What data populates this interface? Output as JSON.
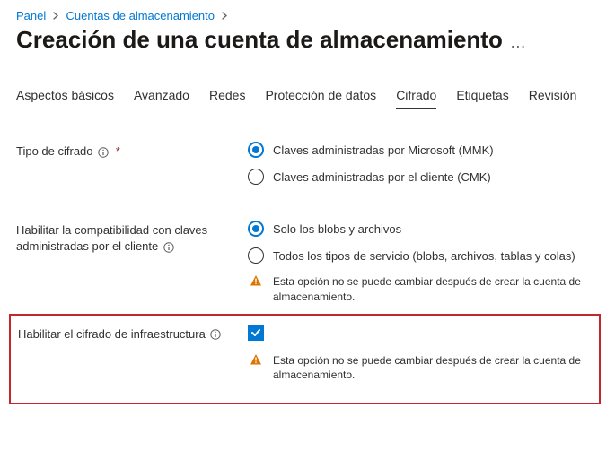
{
  "breadcrumb": {
    "items": [
      "Panel",
      "Cuentas de almacenamiento"
    ]
  },
  "page_title": "Creación de una cuenta de almacenamiento",
  "tabs": {
    "items": [
      {
        "label": "Aspectos básicos"
      },
      {
        "label": "Avanzado"
      },
      {
        "label": "Redes"
      },
      {
        "label": "Protección de datos"
      },
      {
        "label": "Cifrado",
        "active": true
      },
      {
        "label": "Etiquetas"
      },
      {
        "label": "Revisión"
      }
    ]
  },
  "encryption_type": {
    "label": "Tipo de cifrado",
    "required": "*",
    "options": [
      {
        "label": "Claves administradas por Microsoft (MMK)",
        "selected": true
      },
      {
        "label": "Claves administradas por el cliente (CMK)",
        "selected": false
      }
    ]
  },
  "cmk_support": {
    "label": "Habilitar la compatibilidad con claves administradas por el cliente",
    "options": [
      {
        "label": "Solo los blobs y archivos",
        "selected": true
      },
      {
        "label": "Todos los tipos de servicio (blobs, archivos, tablas y colas)",
        "selected": false
      }
    ],
    "warning": "Esta opción no se puede cambiar después de crear la cuenta de almacenamiento."
  },
  "infra_encrypt": {
    "label": "Habilitar el cifrado de infraestructura",
    "checked": true,
    "warning": "Esta opción no se puede cambiar después de crear la cuenta de almacenamiento."
  }
}
